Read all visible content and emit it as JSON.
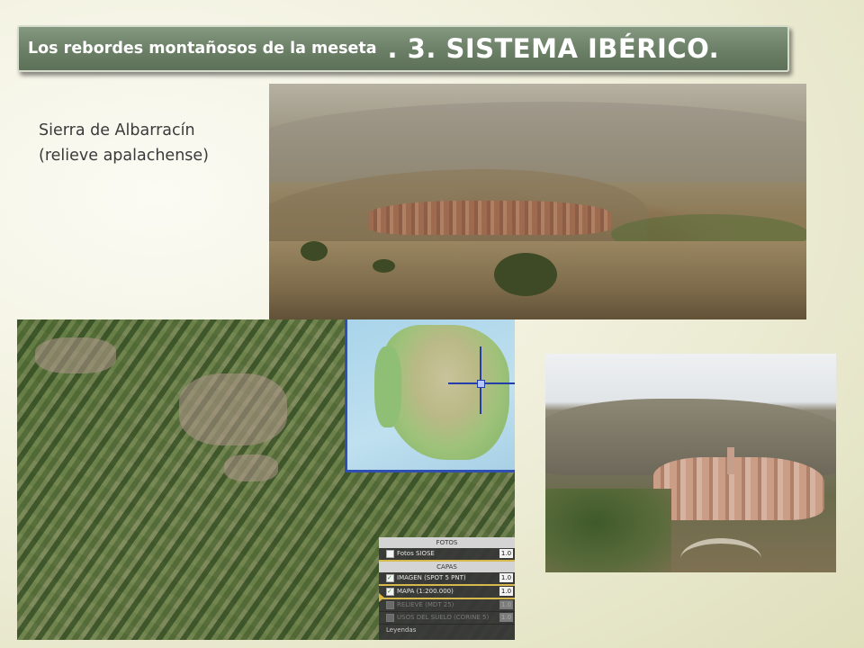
{
  "slide": {
    "title_prefix": "Los rebordes montañosos de la meseta",
    "title_main": ". 3. SISTEMA IBÉRICO.",
    "caption_line1": "Sierra de Albarracín",
    "caption_line2": "(relieve apalachense)"
  },
  "layer_panel": {
    "section_fotos": "FOTOS",
    "section_capas": "CAPAS",
    "rows": [
      {
        "label": "Fotos SIOSE",
        "value": "1.0"
      },
      {
        "label": "IMAGEN (SPOT 5 PNT)",
        "value": "1.0"
      },
      {
        "label": "MAPA (1:200.000)",
        "value": "1.0"
      },
      {
        "label": "RELIEVE (MDT 25)",
        "value": "1.0"
      },
      {
        "label": "USOS DEL SUELO (CORINE 5)",
        "value": "1.0"
      }
    ],
    "legend_label": "Leyendas"
  },
  "colors": {
    "title_bar": "#6a7f66",
    "map_border": "#2f4fb5",
    "panel_highlight": "#d7b84a"
  }
}
